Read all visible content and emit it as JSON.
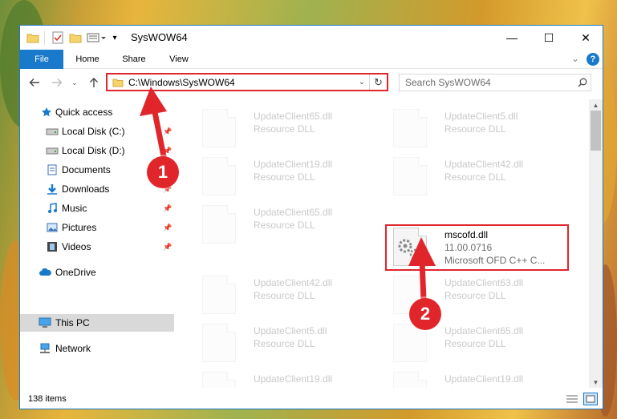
{
  "window": {
    "title": "SysWOW64",
    "controls": {
      "minimize": "—",
      "maximize": "☐",
      "close": "✕"
    }
  },
  "ribbon": {
    "tabs": [
      "File",
      "Home",
      "Share",
      "View"
    ],
    "expand_glyph": "⌄",
    "help_glyph": "?"
  },
  "address": {
    "path": "C:\\Windows\\SysWOW64",
    "search_placeholder": "Search SysWOW64"
  },
  "sidebar": {
    "items": [
      {
        "label": "Quick access",
        "icon": "star-icon",
        "pinned": false
      },
      {
        "label": "Local Disk (C:)",
        "icon": "drive-icon",
        "pinned": true
      },
      {
        "label": "Local Disk (D:)",
        "icon": "drive-icon",
        "pinned": true
      },
      {
        "label": "Documents",
        "icon": "documents-icon",
        "pinned": true
      },
      {
        "label": "Downloads",
        "icon": "download-icon",
        "pinned": true
      },
      {
        "label": "Music",
        "icon": "music-icon",
        "pinned": true
      },
      {
        "label": "Pictures",
        "icon": "pictures-icon",
        "pinned": true
      },
      {
        "label": "Videos",
        "icon": "videos-icon",
        "pinned": true
      },
      {
        "label": "OneDrive",
        "icon": "cloud-icon",
        "pinned": false
      },
      {
        "label": "This PC",
        "icon": "computer-icon",
        "pinned": false,
        "selected": true
      },
      {
        "label": "Network",
        "icon": "network-icon",
        "pinned": false
      }
    ]
  },
  "files": [
    {
      "name": "UpdateClient65.dll",
      "type": "Resource DLL"
    },
    {
      "name": "UpdateClient5.dll",
      "type": "Resource DLL"
    },
    {
      "name": "UpdateClient19.dll",
      "type": "Resource DLL"
    },
    {
      "name": "UpdateClient42.dll",
      "type": "Resource DLL"
    },
    {
      "name": "UpdateClient65.dll",
      "type": "Resource DLL"
    },
    {
      "name": "mscofd.dll",
      "version": "11.00.0716",
      "description": "Microsoft OFD C++ C..."
    },
    {
      "name": "UpdateClient42.dll",
      "type": "Resource DLL"
    },
    {
      "name": "UpdateClient63.dll",
      "type": "Resource DLL"
    },
    {
      "name": "UpdateClient5.dll",
      "type": "Resource DLL"
    },
    {
      "name": "UpdateClient65.dll",
      "type": "Resource DLL"
    },
    {
      "name": "UpdateClient19.dll",
      "type": "Resource DLL"
    },
    {
      "name": "UpdateClient19.dll",
      "type": "Resource DLL"
    }
  ],
  "status": {
    "item_count": "138 items"
  },
  "annotations": {
    "step1": "1",
    "step2": "2"
  },
  "colors": {
    "accent": "#1979ca",
    "annotation": "#e0252b",
    "selected": "#d9d9d9"
  }
}
